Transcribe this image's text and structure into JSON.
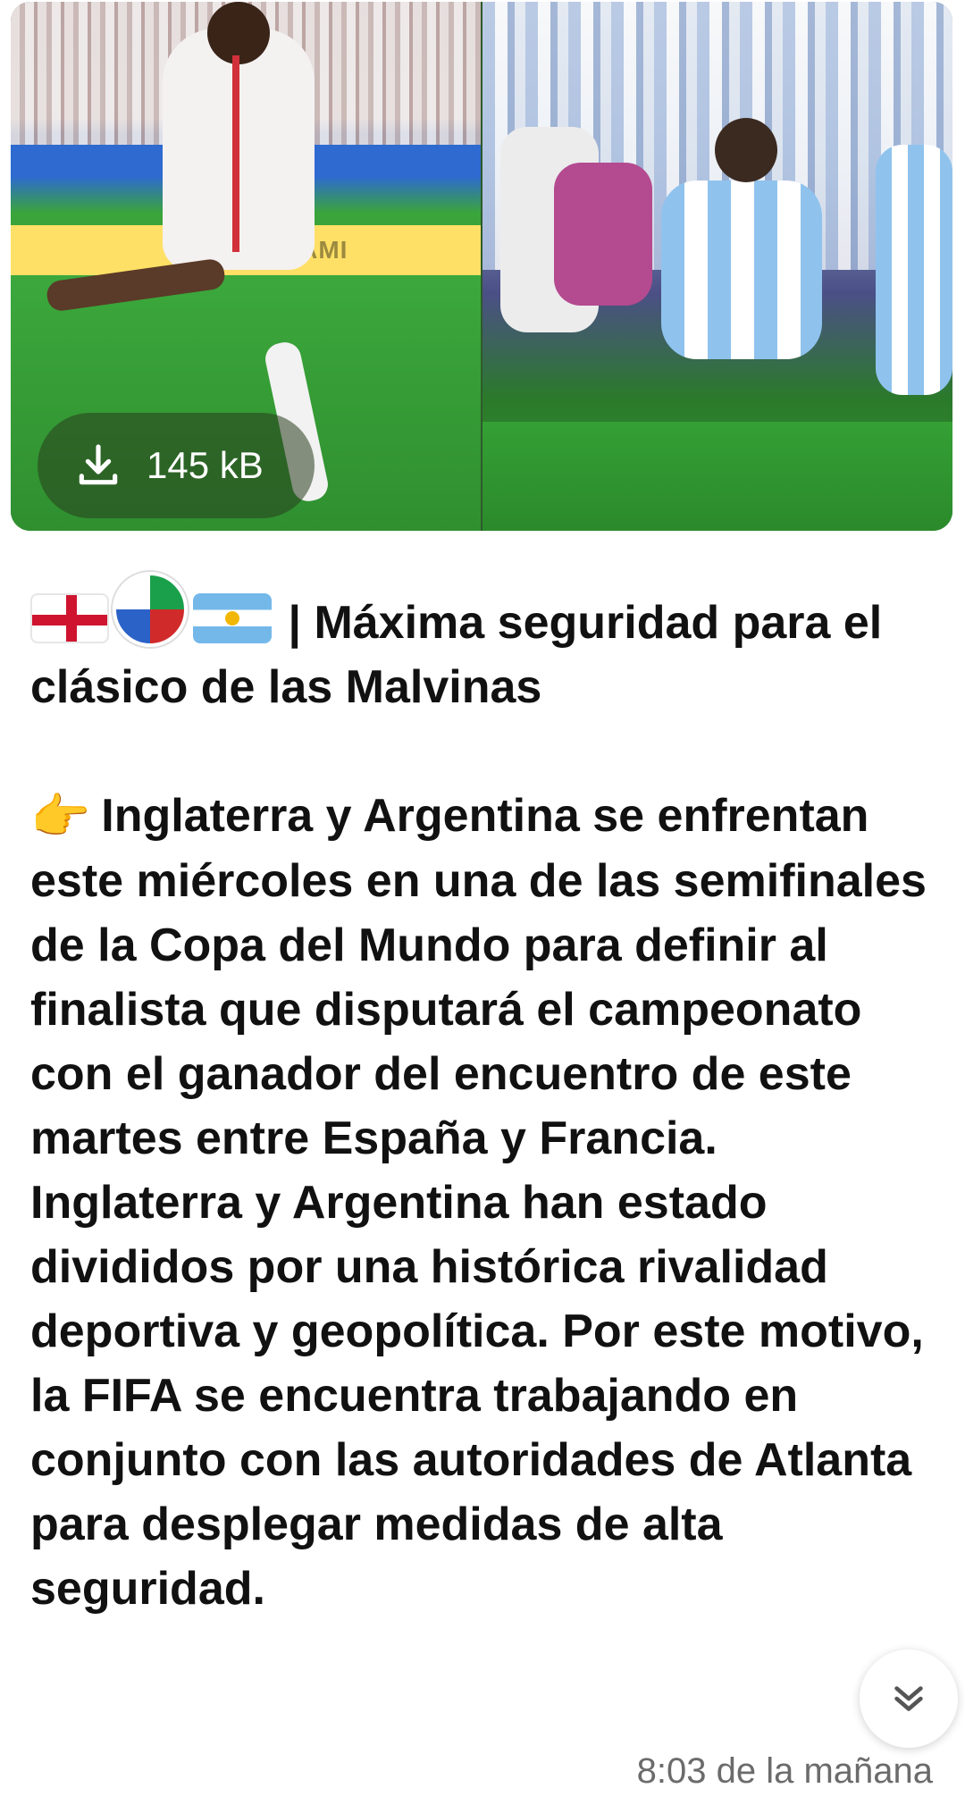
{
  "message": {
    "media": {
      "board_text": "MIAMI",
      "download": {
        "icon": "download-icon",
        "size": "145 kB"
      }
    },
    "caption": {
      "emojis": [
        "england-flag",
        "soccer-ball",
        "argentina-flag"
      ],
      "headline": "| Máxima seguridad para el clásico de las Malvinas",
      "pointer_emoji": "👉",
      "body": "Inglaterra y Argentina se enfrentan este miércoles en una de las semifinales de la Copa del Mundo para definir al finalista que disputará el campeonato con el ganador del encuentro de este martes entre España y Francia. Inglaterra y Argentina han estado divididos por una histórica rivalidad deportiva y geopolítica. Por este motivo, la FIFA se encuentra trabajando en conjunto con las autoridades de Atlanta para desplegar medidas de alta seguridad."
    },
    "timestamp": "8:03 de la mañana",
    "scroll_button_icon": "double-chevron-down-icon"
  }
}
